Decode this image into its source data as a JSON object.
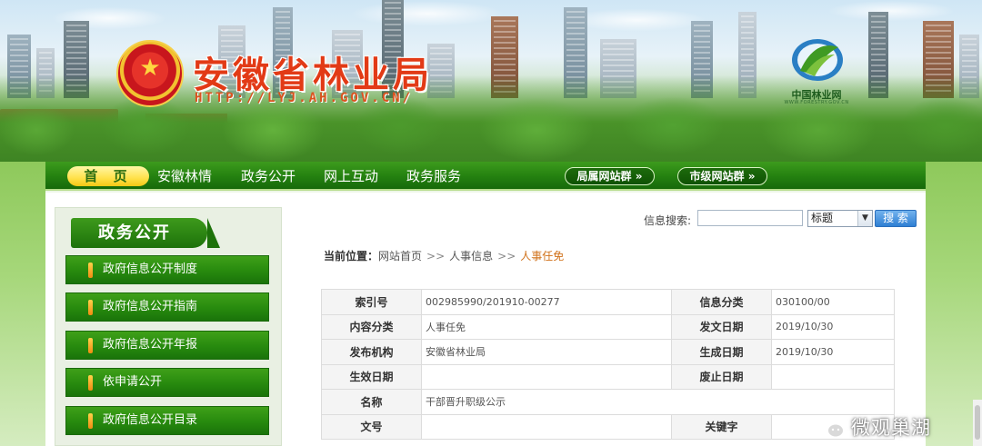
{
  "header": {
    "site_title": "安徽省林业局",
    "site_url": "HTTP://LYJ.AH.GOV.CN/",
    "partner_logo_text": "中国林业网",
    "partner_logo_subtext": "WWW.FORESTRY.GOV.CN"
  },
  "nav": {
    "home": "首 页",
    "items": [
      "安徽林情",
      "政务公开",
      "网上互动",
      "政务服务"
    ],
    "bureau_sites": "局属网站群 »",
    "city_sites": "市级网站群 »"
  },
  "sidebar": {
    "heading": "政务公开",
    "items": [
      "政府信息公开制度",
      "政府信息公开指南",
      "政府信息公开年报",
      "依申请公开",
      "政府信息公开目录"
    ]
  },
  "search": {
    "label": "信息搜索:",
    "input_value": "",
    "select_value": "标题",
    "button": "搜 索"
  },
  "breadcrumb": {
    "lead": "当前位置：",
    "items": [
      "网站首页",
      "人事信息",
      "人事任免"
    ],
    "separator": ">>"
  },
  "info_table": {
    "index_no_label": "索引号",
    "index_no": "002985990/201910-00277",
    "info_category_label": "信息分类",
    "info_category": "030100/00",
    "content_category_label": "内容分类",
    "content_category": "人事任免",
    "issue_date_label": "发文日期",
    "issue_date": "2019/10/30",
    "publisher_label": "发布机构",
    "publisher": "安徽省林业局",
    "generated_date_label": "生成日期",
    "generated_date": "2019/10/30",
    "effective_date_label": "生效日期",
    "effective_date": "",
    "expiry_date_label": "废止日期",
    "expiry_date": "",
    "name_label": "名称",
    "name": "干部晋升职级公示",
    "doc_no_label": "文号",
    "doc_no": "",
    "keywords_label": "关键字",
    "keywords": ""
  },
  "watermark": {
    "text": "微观巢湖"
  },
  "colors": {
    "nav_green": "#268311",
    "home_yellow": "#ffe14a",
    "title_red": "#e23a16",
    "breadcrumb_current": "#d0711a",
    "search_button_blue": "#2f7fd3"
  }
}
